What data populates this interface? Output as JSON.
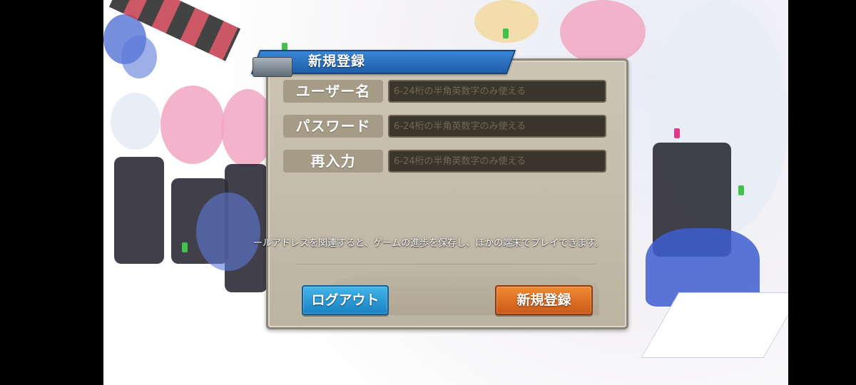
{
  "dialog": {
    "title": "新規登録",
    "fields": [
      {
        "label": "ユーザー名",
        "placeholder": "6-24桁の半角英数字のみ使える",
        "value": ""
      },
      {
        "label": "パスワード",
        "placeholder": "6-24桁の半角英数字のみ使える",
        "value": ""
      },
      {
        "label": "再入力",
        "placeholder": "6-24桁の半角英数字のみ使える",
        "value": ""
      }
    ],
    "info_text": "ールアドレスを関連すると、ゲームの進歩を保存し、ほかの端末でプレイできます。",
    "logout_label": "ログアウト",
    "register_label": "新規登録"
  },
  "colors": {
    "header_blue": "#2a72c0",
    "panel_beige": "#c6bdac",
    "logout_blue": "#2b9ad6",
    "register_orange": "#e07125"
  }
}
